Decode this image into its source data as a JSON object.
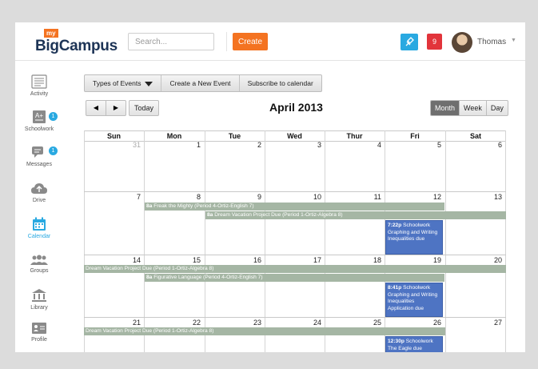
{
  "header": {
    "logo_small": "my",
    "logo_text": "BigCampus",
    "search_placeholder": "Search...",
    "create_label": "Create",
    "notification_count": "9",
    "user_name": "Thomas"
  },
  "sidebar": {
    "items": [
      {
        "label": "Activity",
        "icon": "activity-icon"
      },
      {
        "label": "Schoolwork",
        "icon": "schoolwork-icon",
        "badge": "1"
      },
      {
        "label": "Messages",
        "icon": "messages-icon",
        "badge": "1"
      },
      {
        "label": "Drive",
        "icon": "drive-icon"
      },
      {
        "label": "Calendar",
        "icon": "calendar-icon"
      },
      {
        "label": "Groups",
        "icon": "groups-icon"
      },
      {
        "label": "Library",
        "icon": "library-icon"
      },
      {
        "label": "Profile",
        "icon": "profile-icon"
      }
    ],
    "active": "Calendar"
  },
  "toolbar": {
    "types_label": "Types of Events",
    "create_event_label": "Create a New Event",
    "subscribe_label": "Subscribe to calendar",
    "prev_glyph": "◀",
    "next_glyph": "▶",
    "today_label": "Today",
    "month_title": "April 2013",
    "views": [
      "Month",
      "Week",
      "Day"
    ],
    "active_view": "Month"
  },
  "calendar": {
    "days": [
      "Sun",
      "Mon",
      "Tue",
      "Wed",
      "Thur",
      "Fri",
      "Sat"
    ],
    "weeks": [
      [
        "31",
        "1",
        "2",
        "3",
        "4",
        "5",
        "6"
      ],
      [
        "7",
        "8",
        "9",
        "10",
        "11",
        "12",
        "13"
      ],
      [
        "14",
        "15",
        "16",
        "17",
        "18",
        "19",
        "20"
      ],
      [
        "21",
        "22",
        "23",
        "24",
        "25",
        "26",
        "27"
      ]
    ],
    "events": {
      "freak": {
        "time": "8a",
        "title": "Freak the Mighty (Period 4-Ortiz-English 7)"
      },
      "dream1": {
        "time": "8a",
        "title": "Dream Vacation Project Due (Period 1-Ortiz-Algebra 8)"
      },
      "dream2": {
        "title": "Dream Vacation Project Due (Period 1-Ortiz-Algebra 8)"
      },
      "figurative": {
        "time": "8a",
        "title": "Figurative Language (Period 4-Ortiz-English 7)"
      },
      "dream3": {
        "title": "Dream Vacation Project Due (Period 1-Ortiz-Algebra 8)"
      },
      "sw1": {
        "time": "7:22p",
        "title": "Schoolwork Graphing and Writing Inequalities due"
      },
      "sw2": {
        "time": "8:41p",
        "title": "Schoolwork Graphing and Writing Inequalities Application due"
      },
      "sw3": {
        "time": "12:30p",
        "title": "Schoolwork The Eagle due"
      }
    }
  },
  "colors": {
    "accent_orange": "#f47321",
    "accent_blue": "#29a9e1",
    "event_gray": "#a5b6a4",
    "event_blue": "#4e74c3"
  }
}
